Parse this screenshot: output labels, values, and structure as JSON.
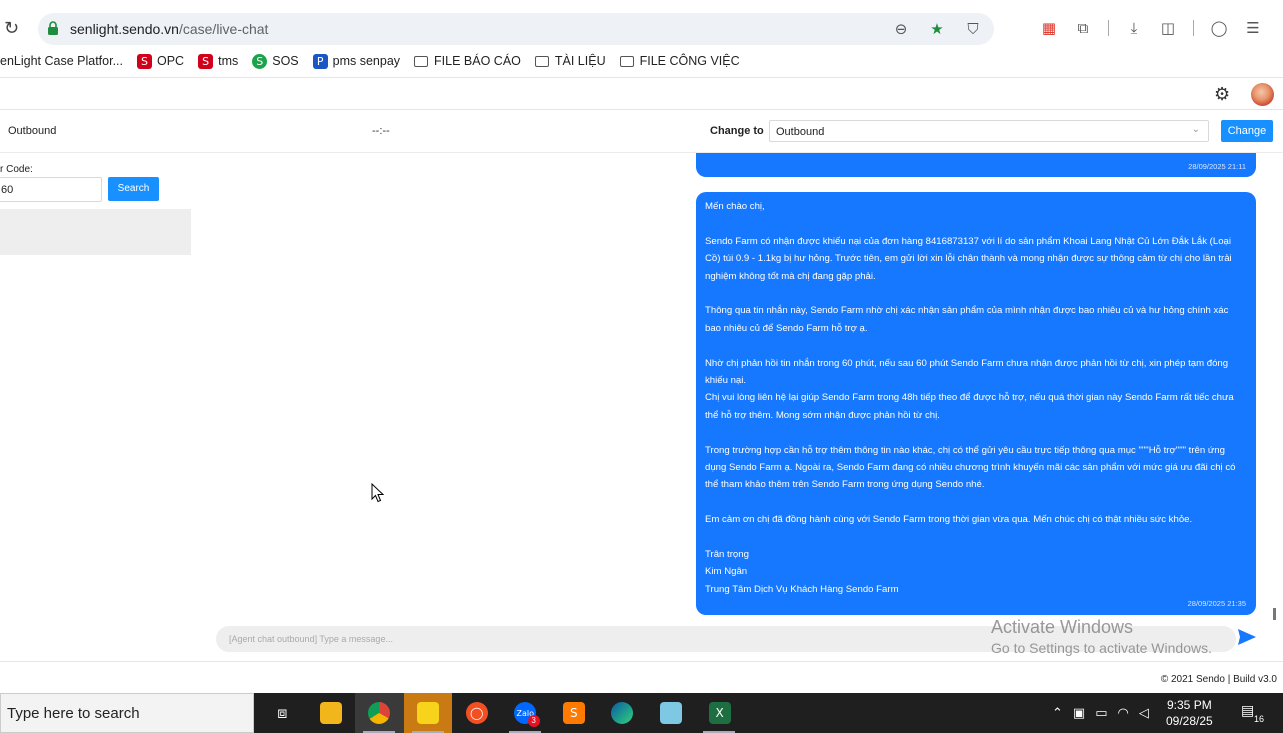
{
  "browser": {
    "url_host": "senlight.sendo.vn",
    "url_path": "/case/live-chat",
    "bookmarks": [
      {
        "label": "enLight Case Platfor...",
        "icon": "none"
      },
      {
        "label": "OPC",
        "icon": "sendo-icon"
      },
      {
        "label": "tms",
        "icon": "sendo-icon"
      },
      {
        "label": "SOS",
        "icon": "sos-icon"
      },
      {
        "label": "pms senpay",
        "icon": "senpay-icon"
      },
      {
        "label": "FILE BÁO CÁO",
        "icon": "folder-icon"
      },
      {
        "label": "TÀI LIỆU",
        "icon": "folder-icon"
      },
      {
        "label": "FILE CÔNG VIỆC",
        "icon": "folder-icon"
      }
    ]
  },
  "info_bar": {
    "chat_type": "Outbound",
    "timer": "--:--",
    "change_to_label": "Change to",
    "change_to_value": "Outbound",
    "change_button": "Change"
  },
  "left_panel": {
    "order_code_label": "r Code:",
    "order_code_value": "60",
    "search_button": "Search"
  },
  "chat": {
    "prev_timestamp": "28/09/2025 21:11",
    "message_paragraphs": [
      "Mến chào chị,",
      "Sendo Farm có nhận được khiếu nại của đơn hàng 8416873137 với lí do sản phẩm Khoai Lang Nhật Củ Lớn Đắk Lắk (Loại Cồ) túi 0.9 - 1.1kg bị hư hỏng. Trước tiên, em gửi lời xin lỗi chân thành và mong nhận được sự thông cảm từ chị cho lần trải nghiệm không tốt mà chị đang gặp phải.",
      "Thông qua tin nhắn này, Sendo Farm nhờ chị xác nhận sản phẩm của mình nhận được bao nhiêu củ và hư hỏng chính xác bao nhiêu củ để Sendo Farm hỗ trợ ạ.",
      "Nhờ chị phản hồi tin nhắn trong 60 phút, nếu sau 60 phút Sendo Farm chưa nhận được phản hồi từ chị, xin phép tạm đóng khiếu nại.\nChị vui lòng liên hệ lại giúp Sendo Farm trong 48h tiếp theo để được hỗ trợ, nếu quá thời gian này Sendo Farm rất tiếc chưa thể hỗ trợ thêm. Mong sớm nhận được phản hồi từ chị.",
      "Trong trường hợp cần hỗ trợ thêm thông tin nào khác, chị có thể gửi yêu cầu trực tiếp thông qua mục \"\"\"Hỗ trợ\"\"\" trên ứng dụng Sendo Farm ạ. Ngoài ra, Sendo Farm đang có nhiều chương trình khuyến mãi các sản phẩm với mức giá ưu đãi chị có thể tham khảo thêm trên Sendo Farm trong ứng dụng Sendo nhé.",
      "Em cảm ơn chị đã đồng hành cùng với Sendo Farm trong thời gian vừa qua. Mến chúc chị có thật nhiều sức khỏe.",
      "Trân trọng\nKim Ngân\nTrung Tâm Dịch Vụ Khách Hàng Sendo Farm"
    ],
    "message_timestamp": "28/09/2025 21:35",
    "input_placeholder": "[Agent chat outbound] Type a message..."
  },
  "watermark": {
    "line1": "Activate Windows",
    "line2": "Go to Settings to activate Windows."
  },
  "footer": {
    "text": "© 2021 Sendo | Build v3.0"
  },
  "taskbar": {
    "search_placeholder": "Type here to search",
    "time": "9:35 PM",
    "date": "09/28/25",
    "notification_count": "16",
    "zalo_badge": "3"
  },
  "colors": {
    "primary": "#1677ff",
    "button": "#1890ff"
  }
}
